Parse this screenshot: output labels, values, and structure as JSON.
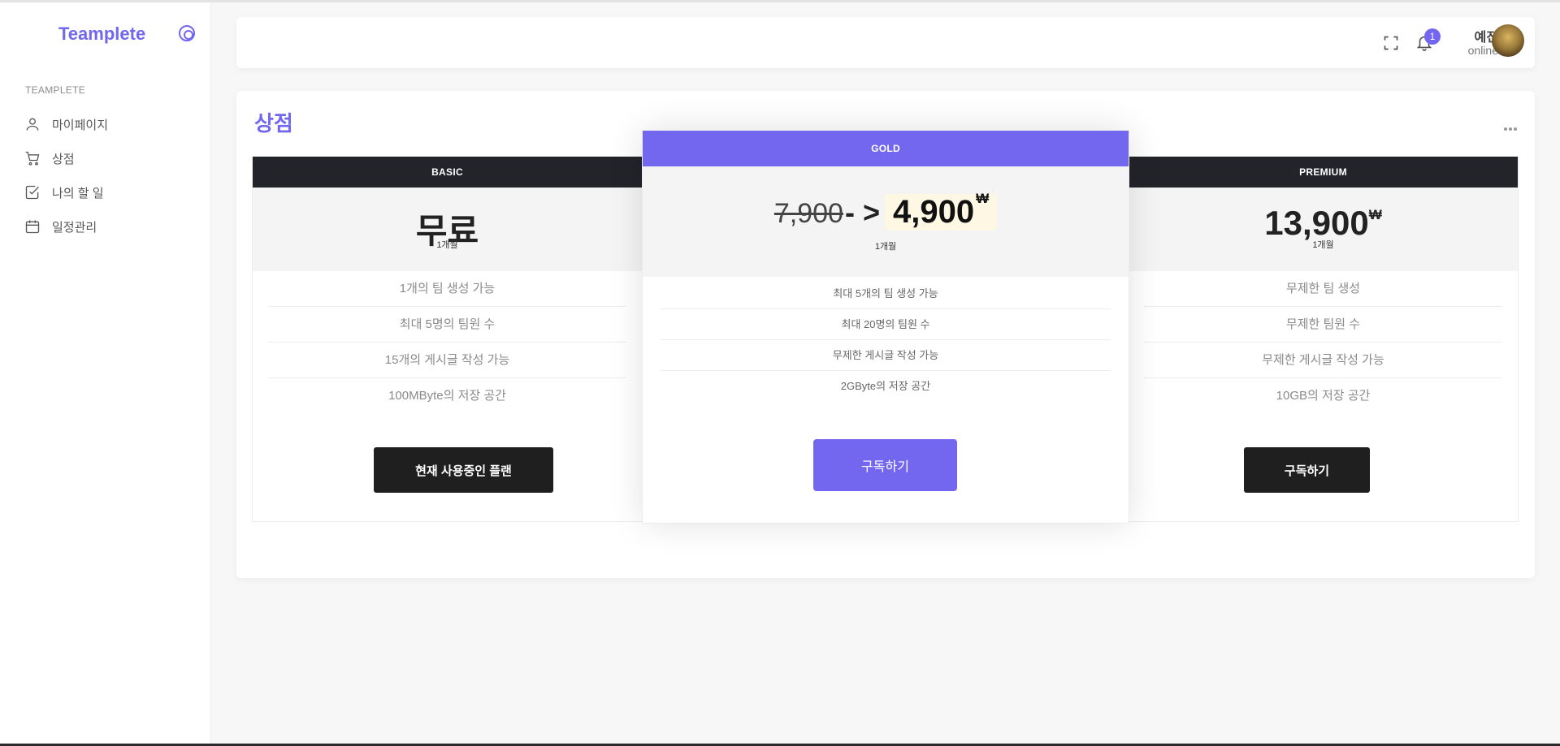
{
  "sidebar": {
    "brand": "Teamplete",
    "section_title": "TEAMPLETE",
    "items": [
      {
        "label": "마이페이지",
        "icon": "user-icon"
      },
      {
        "label": "상점",
        "icon": "cart-icon"
      },
      {
        "label": "나의 할 일",
        "icon": "checkbox-icon"
      },
      {
        "label": "일정관리",
        "icon": "calendar-icon"
      }
    ]
  },
  "header": {
    "notification_count": "1",
    "user_name": "예진",
    "user_status": "online"
  },
  "main": {
    "title": "상점",
    "plans": [
      {
        "name": "BASIC",
        "price": "무료",
        "period": "1개월",
        "features": [
          "1개의 팀 생성 가능",
          "최대 5명의 팀원 수",
          "15개의 게시글 작성 가능",
          "100MByte의 저장 공간"
        ],
        "button": "현재 사용중인 플랜"
      },
      {
        "name": "GOLD",
        "old_price": "7,900",
        "arrow": "- >",
        "price": "4,900",
        "currency": "₩",
        "period": "1개월",
        "features": [
          "최대 5개의 팀 생성 가능",
          "최대 20명의 팀원 수",
          "무제한 게시글 작성 가능",
          "2GByte의 저장 공간"
        ],
        "button": "구독하기"
      },
      {
        "name": "PREMIUM",
        "price": "13,900",
        "currency": "₩",
        "period": "1개월",
        "features": [
          "무제한 팀 생성",
          "무제한 팀원 수",
          "무제한 게시글 작성 가능",
          "10GB의 저장 공간"
        ],
        "button": "구독하기"
      }
    ]
  },
  "colors": {
    "accent": "#7367f0",
    "dark": "#23242a",
    "background": "#f7f7f7"
  }
}
